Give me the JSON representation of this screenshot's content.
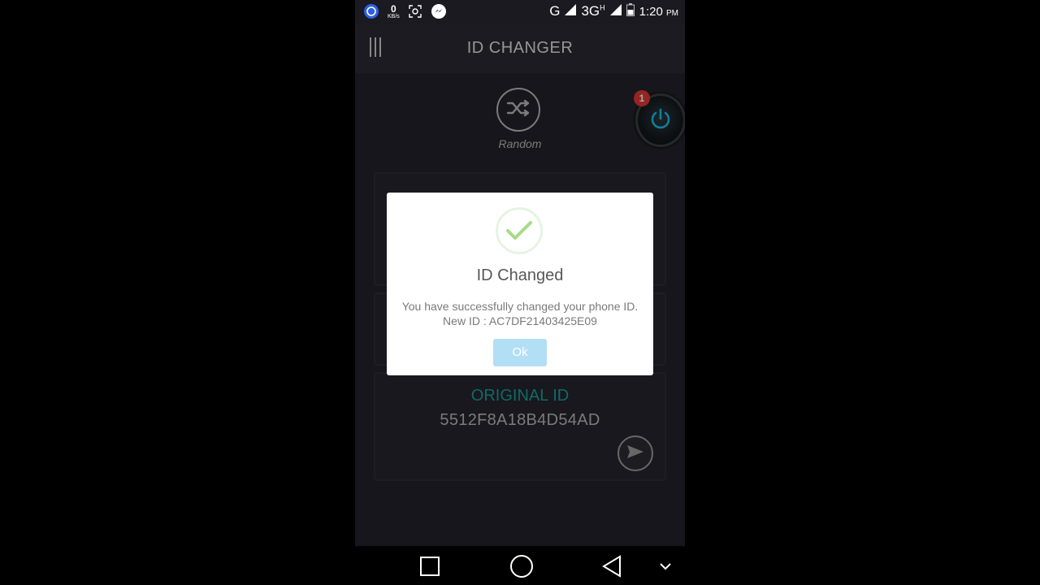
{
  "status_bar": {
    "net_speed_value": "0",
    "net_speed_unit": "KB/s",
    "network_type_1": "G",
    "network_type_2": "3G",
    "network_type_2_sup": "H",
    "time": "1:20",
    "time_suffix": "PM"
  },
  "app_bar": {
    "title": "ID CHANGER"
  },
  "random": {
    "label": "Random"
  },
  "floating_button": {
    "badge_count": "1"
  },
  "cards": {
    "original_id": {
      "title": "ORIGINAL ID",
      "value": "5512F8A18B4D54AD"
    }
  },
  "dialog": {
    "title": "ID Changed",
    "message": "You have successfully changed your phone ID. New ID : AC7DF21403425E09",
    "ok_label": "Ok"
  },
  "colors": {
    "accent_teal": "#1aa39a",
    "success_green": "#a5dc86",
    "ok_button": "#b3dff5",
    "badge_red": "#e53935",
    "power_blue": "#1ec0f0"
  }
}
